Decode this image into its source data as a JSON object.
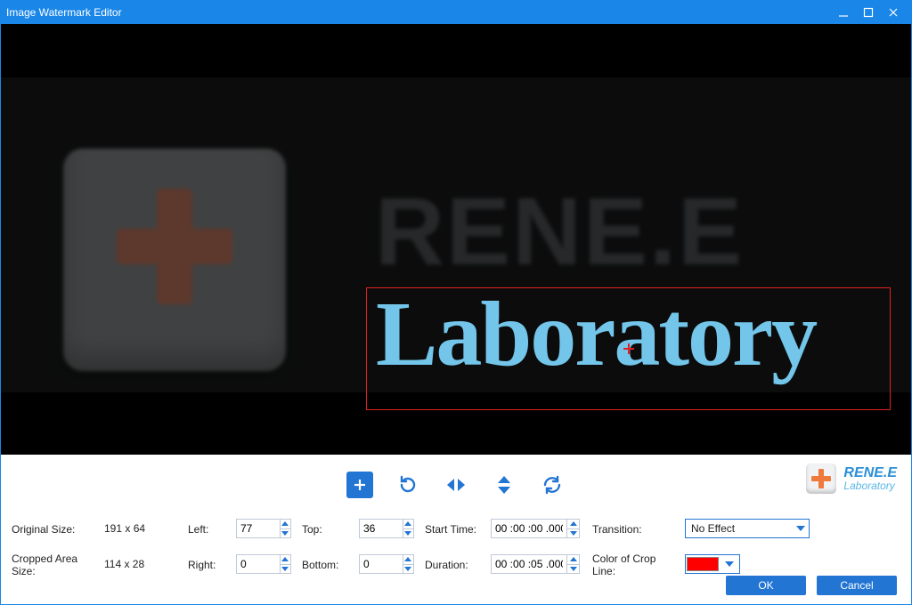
{
  "window": {
    "title": "Image Watermark Editor"
  },
  "preview": {
    "brand_upper": "RENE.E",
    "brand_lower": "Laboratory"
  },
  "logo": {
    "line1": "RENE.E",
    "line2": "Laboratory"
  },
  "toolbar_icons": {
    "add": "add-icon",
    "rotate": "rotate-cw-icon",
    "fliph": "flip-horizontal-icon",
    "flipv": "flip-vertical-icon",
    "reset": "refresh-icon"
  },
  "labels": {
    "original_size": "Original Size:",
    "cropped_size": "Cropped Area Size:",
    "left": "Left:",
    "right": "Right:",
    "top": "Top:",
    "bottom": "Bottom:",
    "start_time": "Start Time:",
    "duration": "Duration:",
    "transition": "Transition:",
    "color_crop": "Color of Crop Line:"
  },
  "values": {
    "original_size": "191 x 64",
    "cropped_size": "114 x 28",
    "left": "77",
    "right": "0",
    "top": "36",
    "bottom": "0",
    "start_time": "00 :00 :00 .000",
    "duration": "00 :00 :05 .000",
    "transition": "No Effect",
    "crop_color": "#ff0000"
  },
  "buttons": {
    "ok": "OK",
    "cancel": "Cancel"
  }
}
